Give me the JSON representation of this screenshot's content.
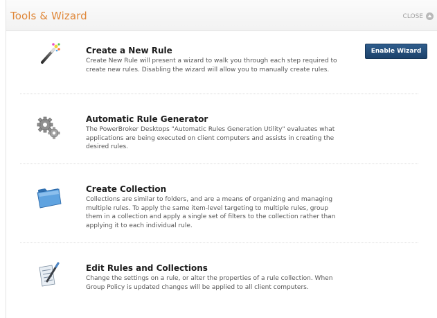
{
  "header": {
    "title": "Tools & Wizard",
    "close_label": "CLOSE"
  },
  "colors": {
    "title_accent": "#e0883a",
    "button_bg": "#234c78"
  },
  "items": [
    {
      "title": "Create a New Rule",
      "description": "Create New Rule will present a wizard to walk you through each step required to create new rules. Disabling the wizard will allow you to manually create rules.",
      "icon": "magic-wand-icon",
      "action_label": "Enable Wizard"
    },
    {
      "title": "Automatic Rule Generator",
      "description": "The PowerBroker Desktops \"Automatic Rules Generation Utility\" evaluates what applications are being executed on client computers and assists in creating the desired rules.",
      "icon": "gears-icon"
    },
    {
      "title": "Create Collection",
      "description": "Collections are similar to folders, and are a means of organizing and managing multiple rules. To apply the same item-level targeting to multiple rules, group them in a collection and apply a single set of filters to the collection rather than applying it to each individual rule.",
      "icon": "folder-icon"
    },
    {
      "title": "Edit Rules and Collections",
      "description": "Change the settings on a rule, or alter the properties of a rule collection. When Group Policy is updated changes will be applied to all client computers.",
      "icon": "edit-document-icon"
    }
  ]
}
